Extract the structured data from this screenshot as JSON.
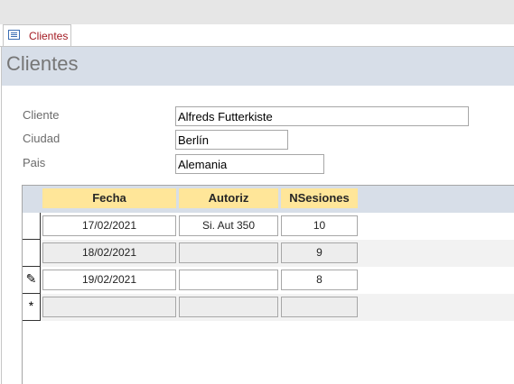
{
  "tab": {
    "label": "Clientes",
    "icon": "form-icon"
  },
  "form": {
    "title": "Clientes"
  },
  "fields": [
    {
      "label": "Cliente",
      "value": "Alfreds Futterkiste"
    },
    {
      "label": "Ciudad",
      "value": "Berlín"
    },
    {
      "label": "Pais",
      "value": "Alemania"
    }
  ],
  "subform": {
    "columns": [
      "Fecha",
      "Autoriz",
      "NSesiones"
    ],
    "rows": [
      {
        "selector": "",
        "fecha": "17/02/2021",
        "autoriz": "Si. Aut 350",
        "nsesiones": "10"
      },
      {
        "selector": "",
        "fecha": "18/02/2021",
        "autoriz": "",
        "nsesiones": "9"
      },
      {
        "selector": "✎",
        "fecha": "19/02/2021",
        "autoriz": "",
        "nsesiones": "8"
      },
      {
        "selector": "*",
        "fecha": "",
        "autoriz": "",
        "nsesiones": ""
      }
    ]
  },
  "colors": {
    "header_bg": "#d7dee8",
    "column_header_bg": "#ffe699",
    "tab_text": "#a31a22"
  }
}
